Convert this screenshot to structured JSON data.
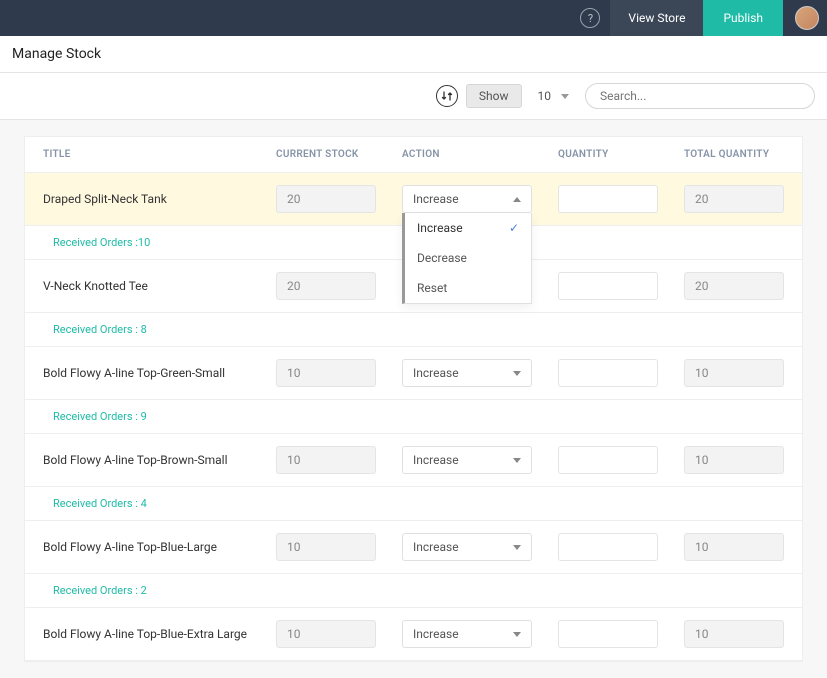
{
  "header": {
    "view_store_label": "View Store",
    "publish_label": "Publish"
  },
  "page": {
    "title": "Manage Stock"
  },
  "toolbar": {
    "show_label": "Show",
    "page_size": "10",
    "search_placeholder": "Search..."
  },
  "columns": {
    "title": "TITLE",
    "current_stock": "CURRENT STOCK",
    "action": "ACTION",
    "quantity": "QUANTITY",
    "total_quantity": "TOTAL QUANTITY"
  },
  "action_options": [
    "Increase",
    "Decrease",
    "Reset"
  ],
  "rows": [
    {
      "title": "Draped Split-Neck Tank",
      "current_stock": "20",
      "action": "Increase",
      "quantity": "",
      "total_quantity": "20",
      "received_orders_label": "Received Orders :10",
      "selected": true,
      "dropdown_open": true,
      "dropdown_selected": "Increase"
    },
    {
      "title": "V-Neck Knotted Tee",
      "current_stock": "20",
      "action": "",
      "quantity": "",
      "total_quantity": "20",
      "received_orders_label": "Received Orders : 8",
      "selected": false,
      "dropdown_open": false
    },
    {
      "title": "Bold Flowy A-line Top-Green-Small",
      "current_stock": "10",
      "action": "Increase",
      "quantity": "",
      "total_quantity": "10",
      "received_orders_label": "Received Orders : 9",
      "selected": false,
      "dropdown_open": false
    },
    {
      "title": "Bold Flowy A-line Top-Brown-Small",
      "current_stock": "10",
      "action": "Increase",
      "quantity": "",
      "total_quantity": "10",
      "received_orders_label": "Received Orders : 4",
      "selected": false,
      "dropdown_open": false
    },
    {
      "title": "Bold Flowy A-line Top-Blue-Large",
      "current_stock": "10",
      "action": "Increase",
      "quantity": "",
      "total_quantity": "10",
      "received_orders_label": "Received Orders : 2",
      "selected": false,
      "dropdown_open": false
    },
    {
      "title": "Bold Flowy A-line Top-Blue-Extra Large",
      "current_stock": "10",
      "action": "Increase",
      "quantity": "",
      "total_quantity": "10",
      "received_orders_label": "",
      "selected": false,
      "dropdown_open": false
    }
  ]
}
